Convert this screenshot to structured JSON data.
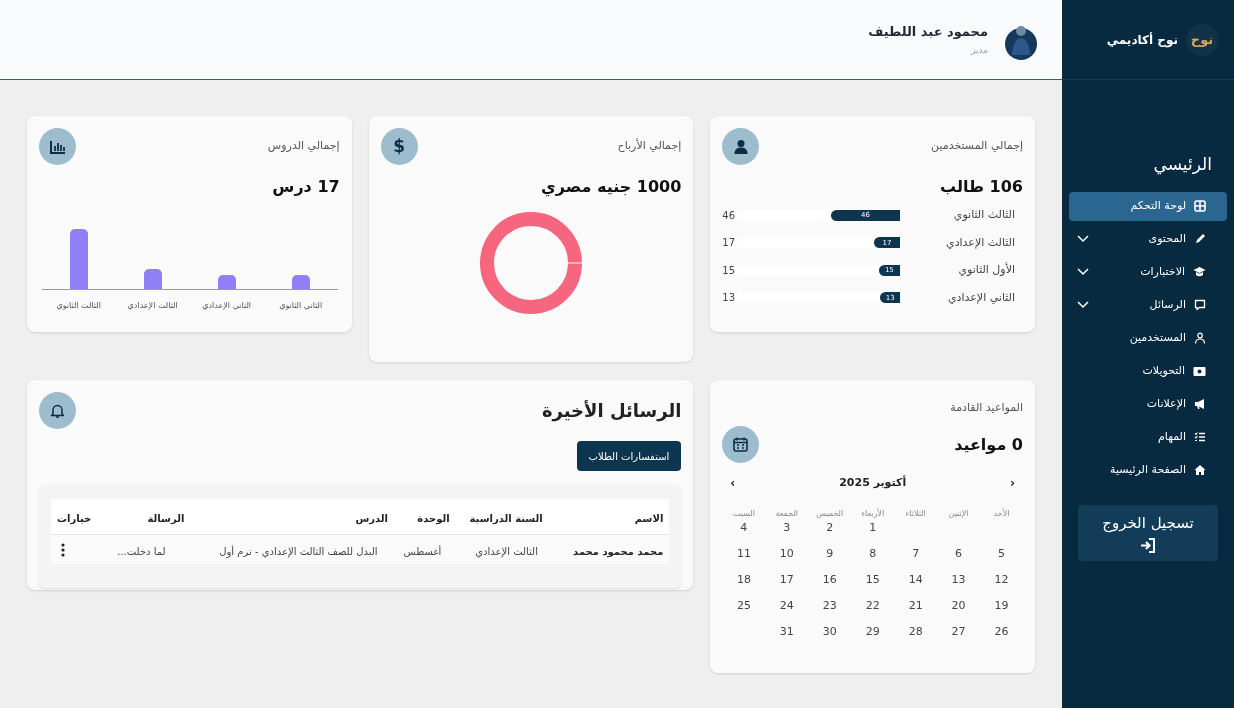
{
  "sidebar": {
    "brand": {
      "logo_text": "نوح",
      "name": "نوح أكاديمي"
    },
    "section_title": "الرئيسي",
    "items": [
      {
        "label": "لوحة التحكم",
        "selected": true,
        "expandable": false
      },
      {
        "label": "المحتوى",
        "selected": false,
        "expandable": true
      },
      {
        "label": "الاختبارات",
        "selected": false,
        "expandable": true
      },
      {
        "label": "الرسائل",
        "selected": false,
        "expandable": true
      },
      {
        "label": "المستخدمين",
        "selected": false,
        "expandable": false
      },
      {
        "label": "التحويلات",
        "selected": false,
        "expandable": false
      },
      {
        "label": "الإعلانات",
        "selected": false,
        "expandable": false
      },
      {
        "label": "المهام",
        "selected": false,
        "expandable": false
      },
      {
        "label": "الصفحة الرئيسية",
        "selected": false,
        "expandable": false
      }
    ],
    "logout": "تسجيل الخروج"
  },
  "header": {
    "user_name": "محمود عبد اللطيف",
    "role": "مدير"
  },
  "users_card": {
    "title": "إجمالي المستخدمين",
    "value": "106 طالب",
    "rows": [
      {
        "label": "الثالث الثانوي",
        "level": 0.42,
        "bar_label": "46",
        "reading": "46"
      },
      {
        "label": "الثالث الإعدادي",
        "level": 0.16,
        "bar_label": "17",
        "reading": "17"
      },
      {
        "label": "الأول الثانوي",
        "level": 0.13,
        "bar_label": "15",
        "reading": "15"
      },
      {
        "label": "الثاني الإعدادي",
        "level": 0.12,
        "bar_label": "13",
        "reading": "13"
      }
    ]
  },
  "profit_card": {
    "title": "إجمالي الأرباح",
    "value": "1000 جنيه مصري",
    "icon_text": "$"
  },
  "lessons_card": {
    "title": "إجمالي الدروس",
    "value": "17 درس",
    "chart_labels": [
      "الثاني الثانوي",
      "الثاني الإعدادي",
      "الثالث الإعدادي",
      "الثالث الثانوي"
    ]
  },
  "appointments_card": {
    "title": "المواعيد القادمة",
    "value": "0 مواعيد",
    "calendar": {
      "prev": "‹",
      "month": "أكتوبر 2025",
      "next": "›",
      "weekdays": [
        "الأحد",
        "الإثنين",
        "الثلاثاء",
        "الأربعاء",
        "الخميس",
        "الجمعة",
        "السبت"
      ],
      "weeks": [
        [
          "1",
          "2",
          "3",
          "4"
        ],
        [
          "5",
          "6",
          "7",
          "8",
          "9",
          "10",
          "11"
        ],
        [
          "12",
          "13",
          "14",
          "15",
          "16",
          "17",
          "18"
        ],
        [
          "19",
          "20",
          "21",
          "22",
          "23",
          "24",
          "25"
        ],
        [
          "26",
          "27",
          "28",
          "29",
          "30",
          "31"
        ]
      ]
    }
  },
  "messages_card": {
    "title": "الرسائل الأخيرة",
    "button": "استفسارات الطلاب",
    "table": {
      "columns": [
        "الاسم",
        "السنة الدراسية",
        "الوحدة",
        "الدرس",
        "الرسالة",
        "خيارات"
      ],
      "rows": [
        {
          "cells": [
            "محمد محمود محمد",
            "الثالث الإعدادي",
            "أغسطس",
            "البدل للصف الثالث الإعدادي - ترم أول",
            "لما دخلت..."
          ]
        }
      ]
    }
  }
}
